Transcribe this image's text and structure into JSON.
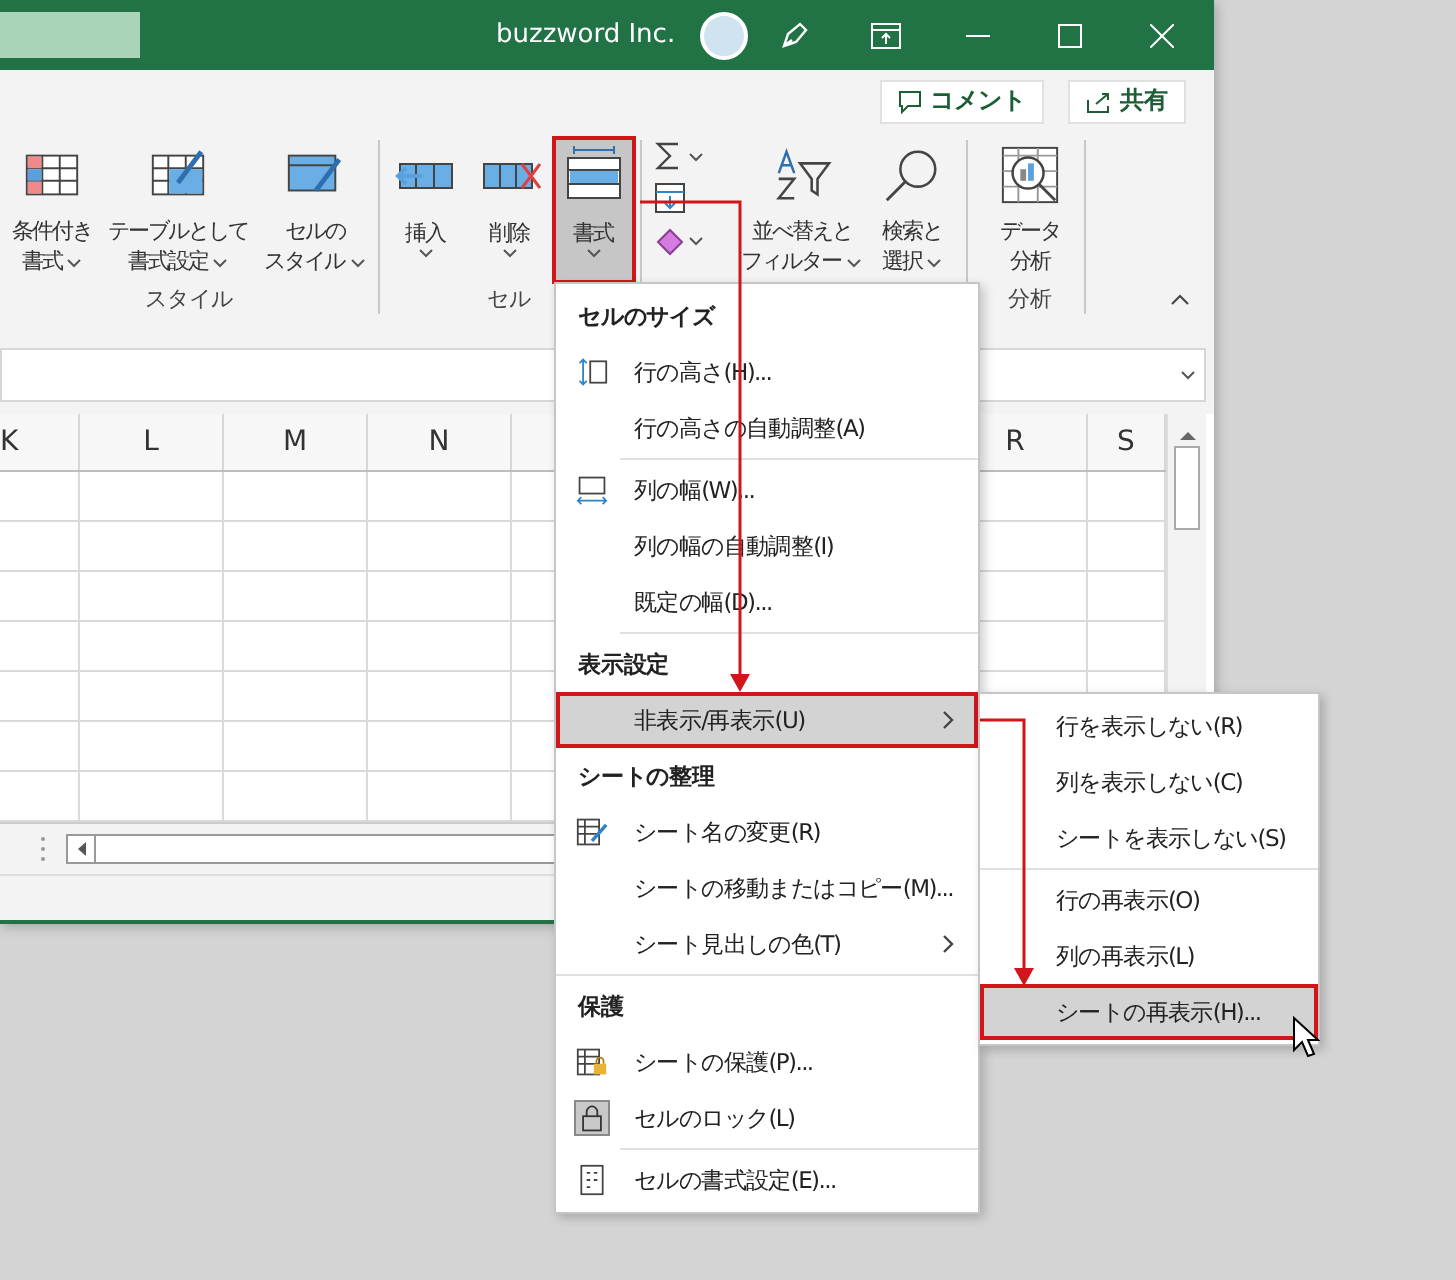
{
  "window": {
    "title": "buzzword Inc."
  },
  "ribbon": {
    "actions": [
      {
        "label": "コメント"
      },
      {
        "label": "共有"
      }
    ],
    "groups": [
      {
        "label": "スタイル",
        "commands": [
          {
            "lines": [
              "条件付き",
              "書式"
            ],
            "dropdown": true,
            "selected": false
          },
          {
            "lines": [
              "テーブルとして",
              "書式設定"
            ],
            "dropdown": true,
            "selected": false
          },
          {
            "lines": [
              "セルの",
              "スタイル"
            ],
            "dropdown": true,
            "selected": false
          }
        ]
      },
      {
        "label": "セル",
        "commands": [
          {
            "lines": [
              "挿入"
            ],
            "dropdown": true,
            "selected": false
          },
          {
            "lines": [
              "削除"
            ],
            "dropdown": true,
            "selected": false
          },
          {
            "lines": [
              "書式"
            ],
            "dropdown": true,
            "selected": true
          }
        ]
      },
      {
        "commands": [
          {
            "lines": [
              "並べ替えと",
              "フィルター"
            ],
            "dropdown": true,
            "selected": false
          },
          {
            "lines": [
              "検索と",
              "選択"
            ],
            "dropdown": true,
            "selected": false
          }
        ]
      },
      {
        "label": "分析",
        "commands": [
          {
            "lines": [
              "データ",
              "分析"
            ],
            "dropdown": false,
            "selected": false
          }
        ]
      }
    ]
  },
  "sheet": {
    "columns": [
      "K",
      "L",
      "M",
      "N",
      "R",
      "S"
    ]
  },
  "format_menu": {
    "items": [
      {
        "kind": "header",
        "label": "セルのサイズ"
      },
      {
        "kind": "command",
        "label": "行の高さ(H)...",
        "selected": false
      },
      {
        "kind": "command",
        "label": "行の高さの自動調整(A)",
        "selected": false
      },
      {
        "kind": "separator"
      },
      {
        "kind": "command",
        "label": "列の幅(W)...",
        "selected": false
      },
      {
        "kind": "command",
        "label": "列の幅の自動調整(I)",
        "selected": false
      },
      {
        "kind": "command",
        "label": "既定の幅(D)...",
        "selected": false
      },
      {
        "kind": "separator"
      },
      {
        "kind": "header",
        "label": "表示設定"
      },
      {
        "kind": "submenu",
        "label": "非表示/再表示(U)",
        "selected": true
      },
      {
        "kind": "header",
        "label": "シートの整理"
      },
      {
        "kind": "command",
        "label": "シート名の変更(R)",
        "selected": false
      },
      {
        "kind": "command",
        "label": "シートの移動またはコピー(M)...",
        "selected": false
      },
      {
        "kind": "submenu",
        "label": "シート見出しの色(T)",
        "selected": false
      },
      {
        "kind": "separator"
      },
      {
        "kind": "header",
        "label": "保護"
      },
      {
        "kind": "command",
        "label": "シートの保護(P)...",
        "selected": false
      },
      {
        "kind": "command",
        "label": "セルのロック(L)",
        "selected": false,
        "checked": true
      },
      {
        "kind": "separator"
      },
      {
        "kind": "command",
        "label": "セルの書式設定(E)...",
        "selected": false
      }
    ]
  },
  "hide_submenu": {
    "items": [
      {
        "kind": "command",
        "label": "行を表示しない(R)",
        "selected": false
      },
      {
        "kind": "command",
        "label": "列を表示しない(C)",
        "selected": false
      },
      {
        "kind": "command",
        "label": "シートを表示しない(S)",
        "selected": false
      },
      {
        "kind": "separator"
      },
      {
        "kind": "command",
        "label": "行の再表示(O)",
        "selected": false
      },
      {
        "kind": "command",
        "label": "列の再表示(L)",
        "selected": false
      },
      {
        "kind": "command",
        "label": "シートの再表示(H)...",
        "selected": true
      }
    ]
  }
}
